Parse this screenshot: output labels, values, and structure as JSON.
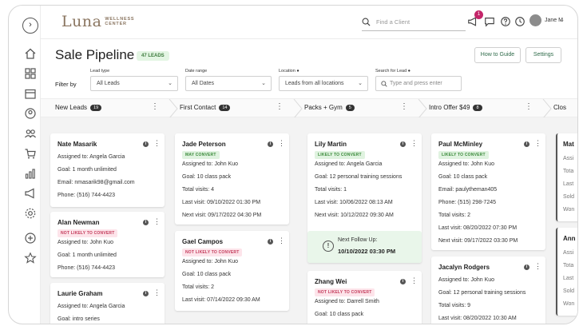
{
  "brand": {
    "name": "Luna",
    "sub1": "WELLNESS",
    "sub2": "CENTER"
  },
  "topbar": {
    "search_placeholder": "Find a Client",
    "notification_count": "1",
    "user_name": "Jane M",
    "user_chevron": "⌄"
  },
  "page": {
    "title": "Sale Pipeline",
    "leads_badge": "47 LEADS",
    "guide_button": "How to Guide",
    "settings_button": "Settings",
    "expand_glyph": "›"
  },
  "filters": {
    "filter_by": "Filter by",
    "lead_type": {
      "label": "Lead type",
      "value": "All Leads"
    },
    "date_range": {
      "label": "Date range",
      "value": "All Dates"
    },
    "location": {
      "label": "Location ●",
      "value": "Leads from all locations"
    },
    "search": {
      "label": "Search for Lead ●",
      "placeholder": "Type and press enter"
    },
    "chevron": "⌄"
  },
  "stages": [
    {
      "name": "New Leads",
      "count": "19"
    },
    {
      "name": "First Contact",
      "count": "14"
    },
    {
      "name": "Packs + Gym",
      "count": "5"
    },
    {
      "name": "Intro Offer $49",
      "count": "8"
    },
    {
      "name": "Clos",
      "count": ""
    }
  ],
  "card_glyphs": {
    "info": "i",
    "menu": "⋮"
  },
  "columns": [
    {
      "cards": [
        {
          "name": "Nate Masarik",
          "tag": "",
          "lines": [
            "Assigned to: Angela Garcia",
            "Goal: 1 month unlimited",
            "Email: nmasarik98@gmail.com",
            "Phone: (516) 744-4423"
          ]
        },
        {
          "name": "Alan Newman",
          "tag": "NOT LIKELY TO CONVERT",
          "lines": [
            "Assigned to: John Kuo",
            "Goal: 1 month unlimited",
            "Phone: (516) 744-4423"
          ]
        },
        {
          "name": "Laurie Graham",
          "tag": "",
          "lines": [
            "Assigned to: Angela Garcia",
            "Goal: intro series"
          ]
        }
      ]
    },
    {
      "cards": [
        {
          "name": "Jade Peterson",
          "tag": "MAY CONVERT",
          "lines": [
            "Assigned to: John Kuo",
            "Goal: 10 class pack",
            "Total visits: 4",
            "Last visit: 09/10/2022 01:30 PM",
            "Next visit: 09/17/2022 04:30 PM"
          ]
        },
        {
          "name": "Gael Campos",
          "tag": "NOT LIKELY TO CONVERT",
          "lines": [
            "Assigned to: John Kuo",
            "Goal: 10 class pack",
            "Total visits: 2",
            "Last visit: 07/14/2022 09:30 AM"
          ]
        }
      ]
    },
    {
      "cards": [
        {
          "name": "Lily Martin",
          "tag": "LIKELY TO CONVERT",
          "lines": [
            "Assigned to: Angela Garcia",
            "Goal: 12 personal training sessions",
            "Total visits: 1",
            "Last visit: 10/06/2022 08:13 AM",
            "Next visit: 10/12/2022 09:30 AM"
          ]
        },
        {
          "name": "Zhang Wei",
          "tag": "NOT LIKELY TO CONVERT",
          "lines": [
            "Assigned to: Darrell Smith",
            "Goal: 10 class pack"
          ]
        }
      ],
      "followup": {
        "icon": "!",
        "label": "Next Follow Up:",
        "datetime": "10/10/2022 03:30 PM"
      }
    },
    {
      "cards": [
        {
          "name": "Paul McMinley",
          "tag": "LIKELY TO CONVERT",
          "lines": [
            "Assigned to: John Kuo",
            "Goal: 10 class pack",
            "Email: paulytheman405",
            "Phone: (515) 298-7245",
            "Total visits: 2",
            "Last visit: 08/20/2022 07:30 PM",
            "Next visit: 09/17/2022 03:30 PM"
          ]
        },
        {
          "name": "Jacalyn Rodgers",
          "tag": "",
          "lines": [
            "Assigned to: John Kuo",
            "Goal: 12 personal training sessions",
            "Total visits: 9",
            "Last visit: 08/20/2022 10:30 AM"
          ]
        }
      ]
    },
    {
      "cards": [
        {
          "name": "Mat",
          "tag": "",
          "lines": [
            "Assi",
            "Tota",
            "Last",
            "Sold",
            "Won"
          ]
        },
        {
          "name": "Ann",
          "tag": "",
          "lines": [
            "Assi",
            "Tota",
            "Last",
            "Sold",
            "Won"
          ]
        }
      ]
    }
  ],
  "colors": {
    "accent_green": "#3c7a3c",
    "tag_red": "#c33a5a",
    "badge_pink": "#c4266a",
    "brand_brown": "#8a7560"
  }
}
